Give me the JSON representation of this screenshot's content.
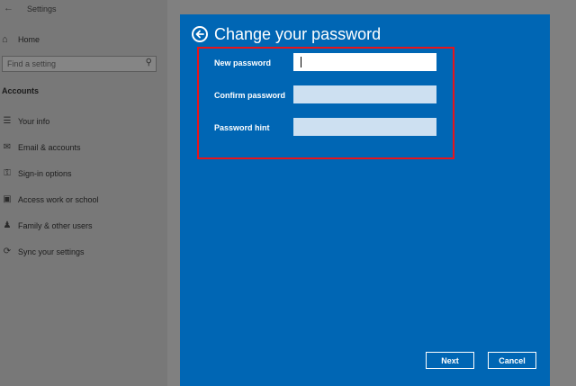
{
  "settings": {
    "app_title": "Settings",
    "home_label": "Home",
    "search_placeholder": "Find a setting",
    "section_title": "Accounts",
    "nav_items": [
      {
        "label": "Your info",
        "icon": "person-card-icon"
      },
      {
        "label": "Email & accounts",
        "icon": "mail-icon"
      },
      {
        "label": "Sign-in options",
        "icon": "key-icon"
      },
      {
        "label": "Access work or school",
        "icon": "briefcase-icon"
      },
      {
        "label": "Family & other users",
        "icon": "people-icon"
      },
      {
        "label": "Sync your settings",
        "icon": "sync-icon"
      }
    ]
  },
  "dialog": {
    "title": "Change your password",
    "fields": [
      {
        "label": "New password",
        "value": "",
        "placeholder": ""
      },
      {
        "label": "Confirm password",
        "value": "",
        "placeholder": ""
      },
      {
        "label": "Password hint",
        "value": "",
        "placeholder": ""
      }
    ],
    "next_label": "Next",
    "cancel_label": "Cancel",
    "colors": {
      "background": "#0066b4",
      "highlight_border": "#e8141b",
      "input_active": "#ffffff",
      "input_inactive": "#cde0f1"
    }
  }
}
